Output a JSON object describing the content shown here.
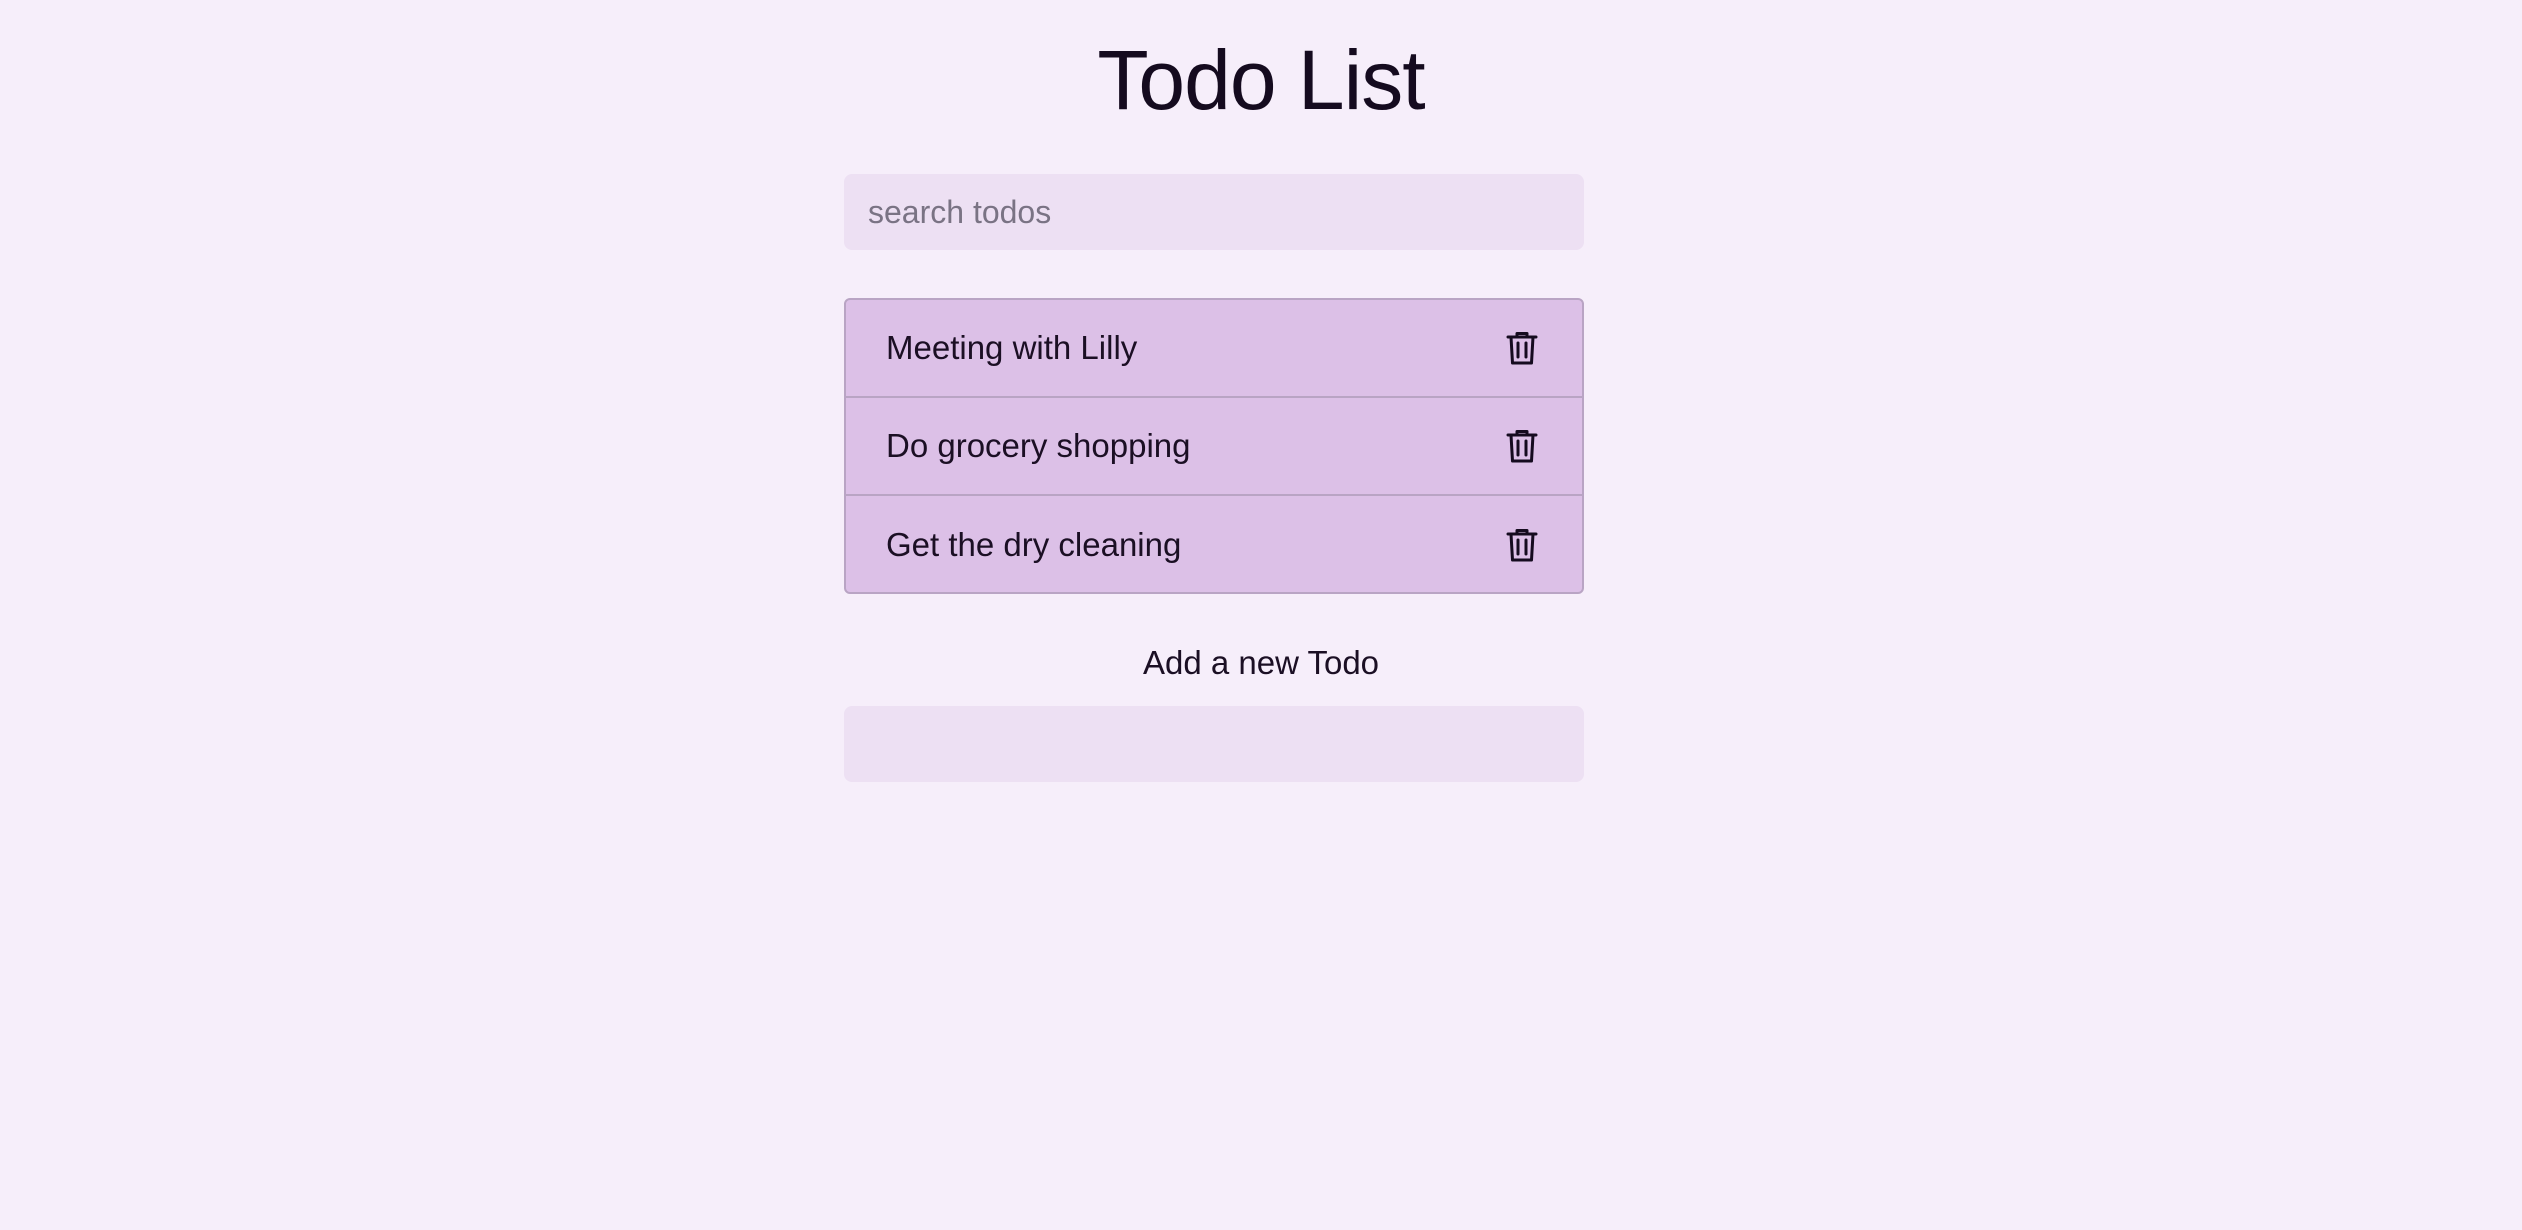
{
  "header": {
    "title": "Todo List"
  },
  "search": {
    "placeholder": "search todos",
    "value": ""
  },
  "todos": [
    {
      "text": "Meeting with Lilly",
      "action_icon": "trash-icon"
    },
    {
      "text": "Do grocery shopping",
      "action_icon": "trash-icon"
    },
    {
      "text": "Get the dry cleaning",
      "action_icon": "trash-icon"
    }
  ],
  "add_form": {
    "label": "Add a new Todo",
    "value": ""
  },
  "colors": {
    "background": "#f6eefa",
    "input_background": "#ede0f3",
    "list_background": "#dcc0e7",
    "list_border": "#b9a4c4",
    "text": "#1b0f24"
  }
}
